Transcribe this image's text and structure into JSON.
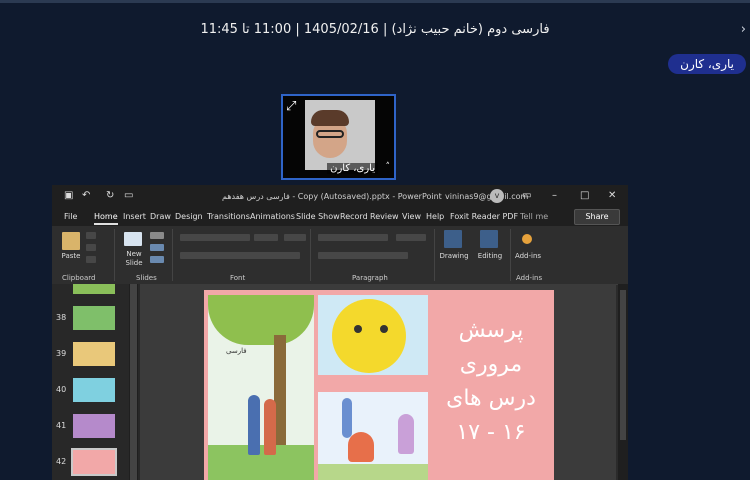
{
  "header": {
    "meeting_title": "فارسی دوم (خانم حبیب نژاد) | 1405/02/16 | 11:00 تا 11:45",
    "participant_pill": "یاری، کارن",
    "back_glyph": "›"
  },
  "video": {
    "name": "یاری، کارن",
    "expand_glyph": "⤢",
    "chevron_glyph": "˄"
  },
  "ppt": {
    "doc_title": "فارسی درس هفدهم - Copy (Autosaved).pptx  -  PowerPoint",
    "account": "vininas9@gmail.com",
    "avatar_letter": "v",
    "tabs": [
      "File",
      "Home",
      "Insert",
      "Draw",
      "Design",
      "Transitions",
      "Animations",
      "Slide Show",
      "Record",
      "Review",
      "View",
      "Help",
      "Foxit Reader PDF"
    ],
    "active_tab": "Home",
    "tell_me": "Tell me",
    "share": "Share",
    "ribbon": {
      "paste": "Paste",
      "new_slide": "New",
      "new_slide_2": "Slide",
      "drawing": "Drawing",
      "editing": "Editing",
      "addins": "Add-ins",
      "groups": [
        "Clipboard",
        "Slides",
        "Font",
        "Paragraph",
        "Add-ins"
      ]
    },
    "thumbnails": [
      {
        "num": "38"
      },
      {
        "num": "39"
      },
      {
        "num": "40"
      },
      {
        "num": "41"
      },
      {
        "num": "42"
      }
    ],
    "slide": {
      "lines": [
        "پرسش",
        "مروری",
        "درس های",
        "۱۶ - ۱۷"
      ],
      "book_label": "فارسی"
    }
  },
  "colors": {
    "background": "#0f1a2e",
    "pill": "#1f2f8f",
    "tile_border": "#2f64c8",
    "slide_bg": "#f2a8a8"
  }
}
